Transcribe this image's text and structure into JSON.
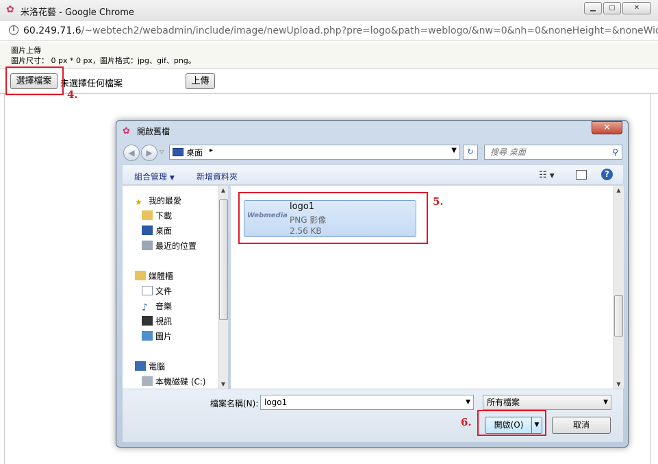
{
  "browser": {
    "title": "米洛花藝 - Google Chrome",
    "url_host": "60.249.71.6",
    "url_path": "/~webtech2/webadmin/include/image/newUpload.php?pre=logo&path=weblogo/&nw=0&nh=0&noneHeight=&noneWidth="
  },
  "page": {
    "heading": "圖片上傳",
    "spec": "圖片尺寸： 0 px * 0 px，圖片格式：jpg、gif、png。",
    "choose_file_label": "選擇檔案",
    "no_file_text": "未選擇任何檔案",
    "upload_label": "上傳"
  },
  "annotations": {
    "step4": "4.",
    "step5": "5.",
    "step6": "6."
  },
  "dialog": {
    "title": "開啟舊檔",
    "path": "桌面",
    "path_sep": "▸",
    "search_placeholder": "搜尋 桌面",
    "toolbar": {
      "organize": "組合管理",
      "new_folder": "新增資料夾"
    },
    "nav": {
      "favorites": "我的最愛",
      "downloads": "下載",
      "desktop": "桌面",
      "recent": "最近的位置",
      "libraries": "媒體櫃",
      "documents": "文件",
      "music": "音樂",
      "videos": "視訊",
      "pictures": "圖片",
      "computer": "電腦",
      "local_disk": "本機磁碟 (C:)"
    },
    "file": {
      "name": "logo1",
      "type": "PNG 影像",
      "size": "2.56 KB",
      "thumb_text": "Webmedia"
    },
    "filename_label": "檔案名稱(N):",
    "filename_value": "logo1",
    "filter_value": "所有檔案",
    "open_label": "開啟(O)",
    "cancel_label": "取消"
  }
}
